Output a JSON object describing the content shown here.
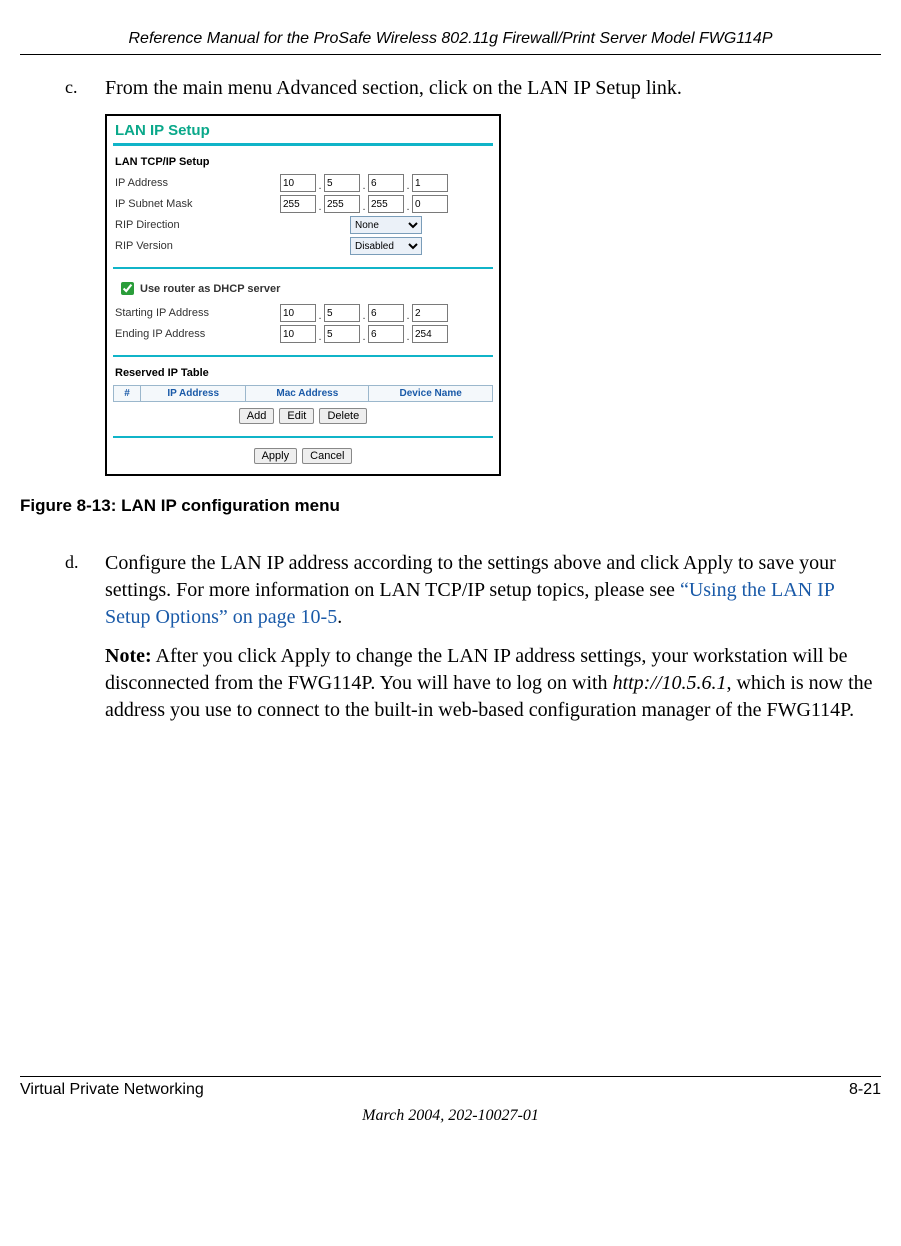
{
  "header": {
    "title": "Reference Manual for the ProSafe Wireless 802.11g  Firewall/Print Server Model FWG114P"
  },
  "step_c": {
    "marker": "c.",
    "text": "From the main menu Advanced section, click on the LAN IP Setup link."
  },
  "fig": {
    "title": "LAN IP Setup",
    "tcpip_head": "LAN TCP/IP Setup",
    "labels": {
      "ip_address": "IP Address",
      "subnet": "IP Subnet Mask",
      "rip_dir": "RIP Direction",
      "rip_ver": "RIP Version",
      "dhcp_check": "Use router as DHCP server",
      "start_ip": "Starting IP Address",
      "end_ip": "Ending IP Address",
      "reserved_head": "Reserved IP Table"
    },
    "ip": [
      "10",
      "5",
      "6",
      "1"
    ],
    "subnet": [
      "255",
      "255",
      "255",
      "0"
    ],
    "rip_dir_val": "None",
    "rip_ver_val": "Disabled",
    "start_ip": [
      "10",
      "5",
      "6",
      "2"
    ],
    "end_ip": [
      "10",
      "5",
      "6",
      "254"
    ],
    "cols": {
      "num": "#",
      "ip": "IP Address",
      "mac": "Mac Address",
      "dev": "Device Name"
    },
    "btns": {
      "add": "Add",
      "edit": "Edit",
      "del": "Delete",
      "apply": "Apply",
      "cancel": "Cancel"
    }
  },
  "caption": "Figure 8-13:  LAN IP configuration menu",
  "step_d": {
    "marker": "d.",
    "p1": "Configure the LAN IP address according to the settings above and click Apply to save your settings. For more information on LAN TCP/IP setup topics, please see ",
    "link": "“Using the LAN IP Setup Options” on page 10-5",
    "p1_end": ".",
    "note_label": "Note:",
    "note": " After you click Apply to change the LAN IP address settings, your workstation will be disconnected from the FWG114P. You will have to log on with ",
    "note_url": "http://10.5.6.1",
    "note_end": ", which is now the address you use to connect to the built-in web-based configuration manager of the FWG114P."
  },
  "footer": {
    "left": "Virtual Private Networking",
    "right": "8-21",
    "date": "March 2004, 202-10027-01"
  }
}
